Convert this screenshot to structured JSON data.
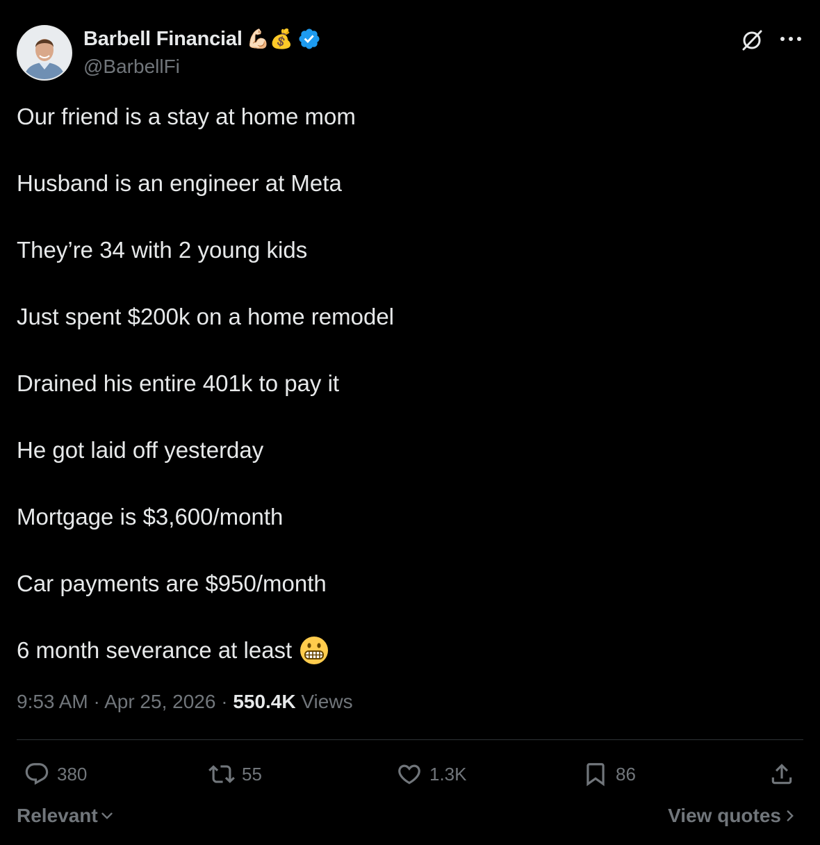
{
  "author": {
    "display_name": "Barbell Financial",
    "emojis": "💪🏻💰",
    "handle": "@BarbellFi",
    "verified": true
  },
  "tweet": {
    "lines": [
      "Our friend is a stay at home mom",
      "Husband is an engineer at Meta",
      "They’re 34 with 2 young kids",
      "Just spent $200k on a home remodel",
      "Drained his entire 401k to pay it",
      "He got laid off yesterday",
      "Mortgage is $3,600/month",
      "Car payments are $950/month",
      "6 month severance at least"
    ],
    "trailing_emoji": "grimacing-face"
  },
  "meta": {
    "time": "9:53 AM",
    "date": "Apr 25, 2026",
    "views_count": "550.4K",
    "views_label": "Views",
    "separator": "·"
  },
  "actions": {
    "replies": "380",
    "reposts": "55",
    "likes": "1.3K",
    "bookmarks": "86"
  },
  "footer": {
    "sort_label": "Relevant",
    "view_quotes_label": "View quotes"
  },
  "colors": {
    "background": "#000000",
    "text": "#e7e9ea",
    "secondary": "#71767b",
    "verified_blue": "#1d9bf0",
    "divider": "#2f3336"
  }
}
